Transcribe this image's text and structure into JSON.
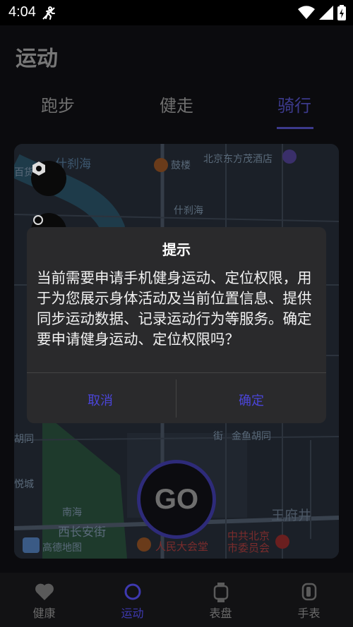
{
  "status_bar": {
    "time": "4:04",
    "icons": [
      "no-gps-icon",
      "wifi-icon",
      "signal-icon",
      "battery-charging-icon"
    ]
  },
  "page": {
    "title": "运动"
  },
  "tabs": [
    {
      "label": "跑步",
      "active": false
    },
    {
      "label": "健走",
      "active": false
    },
    {
      "label": "骑行",
      "active": true
    }
  ],
  "map": {
    "labels": [
      {
        "text": "什刹海"
      },
      {
        "text": "鼓楼"
      },
      {
        "text": "北京东方茂酒店"
      },
      {
        "text": "百货"
      },
      {
        "text": "什刹海"
      },
      {
        "text": "胡同"
      },
      {
        "text": "悦城"
      },
      {
        "text": "南海"
      },
      {
        "text": "西长安街"
      },
      {
        "text": "人民大会堂"
      },
      {
        "text": "王府井"
      },
      {
        "text": "中共北京市委员会"
      },
      {
        "text": "金鱼胡同"
      },
      {
        "text": "街"
      },
      {
        "text": "高德地图"
      }
    ],
    "accent_color": "#2e2b7a"
  },
  "go_button": {
    "label": "GO"
  },
  "dialog": {
    "title": "提示",
    "body": "当前需要申请手机健身运动、定位权限，用于为您展示身体活动及当前位置信息、提供同步运动数据、记录运动行为等服务。确定要申请健身运动、定位权限吗？",
    "cancel_label": "取消",
    "confirm_label": "确定"
  },
  "bottom_nav": [
    {
      "label": "健康",
      "icon": "heart-icon",
      "active": false
    },
    {
      "label": "运动",
      "icon": "activity-ring-icon",
      "active": true
    },
    {
      "label": "表盘",
      "icon": "watch-face-icon",
      "active": false
    },
    {
      "label": "手表",
      "icon": "watch-icon",
      "active": false
    }
  ],
  "colors": {
    "accent": "#3c3a8c",
    "dialog_button": "#4b45d9",
    "dialog_bg": "#2a2a2c"
  }
}
